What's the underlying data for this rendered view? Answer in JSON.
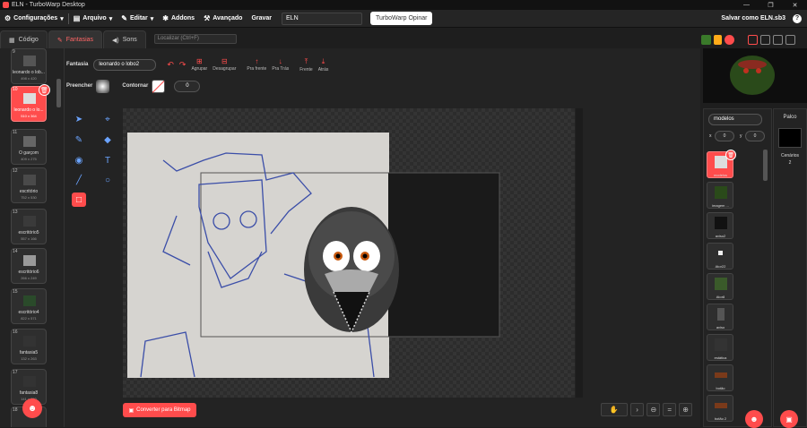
{
  "window": {
    "title": "ELN - TurboWarp Desktop",
    "controls": [
      "—",
      "❐",
      "✕"
    ]
  },
  "menubar": {
    "settings": "Configurações",
    "file": "Arquivo",
    "edit": "Editar",
    "addons": "Addons",
    "advanced": "Avançado",
    "record": "Gravar",
    "project_title": "ELN",
    "share": "TurboWarp Opinar",
    "save_as": "Salvar como ELN.sb3",
    "help": "?"
  },
  "tabs": {
    "code": "Código",
    "costumes": "Fantasias",
    "sounds": "Sons",
    "find_placeholder": "Localizar (Ctrl+F)"
  },
  "costumes": [
    {
      "num": "9",
      "name": "leonardo o lob...",
      "size": "498 x 420"
    },
    {
      "num": "10",
      "name": "leonardo o lo...",
      "size": "510 x 364"
    },
    {
      "num": "11",
      "name": "O garçom",
      "size": "409 x 275"
    },
    {
      "num": "12",
      "name": "escritório",
      "size": "752 x 530"
    },
    {
      "num": "13",
      "name": "escritório5",
      "size": "557 x 166"
    },
    {
      "num": "14",
      "name": "escritório6",
      "size": "266 x 249"
    },
    {
      "num": "15",
      "name": "escritório4",
      "size": "822 x 571"
    },
    {
      "num": "16",
      "name": "fantasia5",
      "size": "132 x 263"
    },
    {
      "num": "17",
      "name": "fantasia8",
      "size": "141 x 250"
    },
    {
      "num": "18",
      "name": "",
      "size": ""
    }
  ],
  "editor": {
    "costume_label": "Fantasia",
    "costume_name": "leonardo o lobo2",
    "group": "Agrupar",
    "ungroup": "Desagrupar",
    "forward": "Pra frente",
    "backward": "Pra Trás",
    "front": "Frente",
    "back": "Atrás",
    "fill_label": "Preencher",
    "outline_label": "Contornar",
    "outline_width": "0",
    "convert": "Converter para Bitmap"
  },
  "sprite_info": {
    "name": "modelos",
    "x_label": "x",
    "x": "0",
    "y_label": "y",
    "y": "0"
  },
  "sprites": [
    {
      "name": "modelos"
    },
    {
      "name": "imagem ..."
    },
    {
      "name": "aviso2"
    },
    {
      "name": "Ator22"
    },
    {
      "name": "Ator8"
    },
    {
      "name": "aviso"
    },
    {
      "name": "estática"
    },
    {
      "name": "botão"
    },
    {
      "name": "botão 2"
    }
  ],
  "stage_pane": {
    "title": "Palco",
    "backdrops_label": "Cenários",
    "backdrops_count": "2"
  },
  "colors": {
    "accent": "#ff4c4c",
    "bg": "#1e1e1e",
    "panel": "#232323"
  }
}
